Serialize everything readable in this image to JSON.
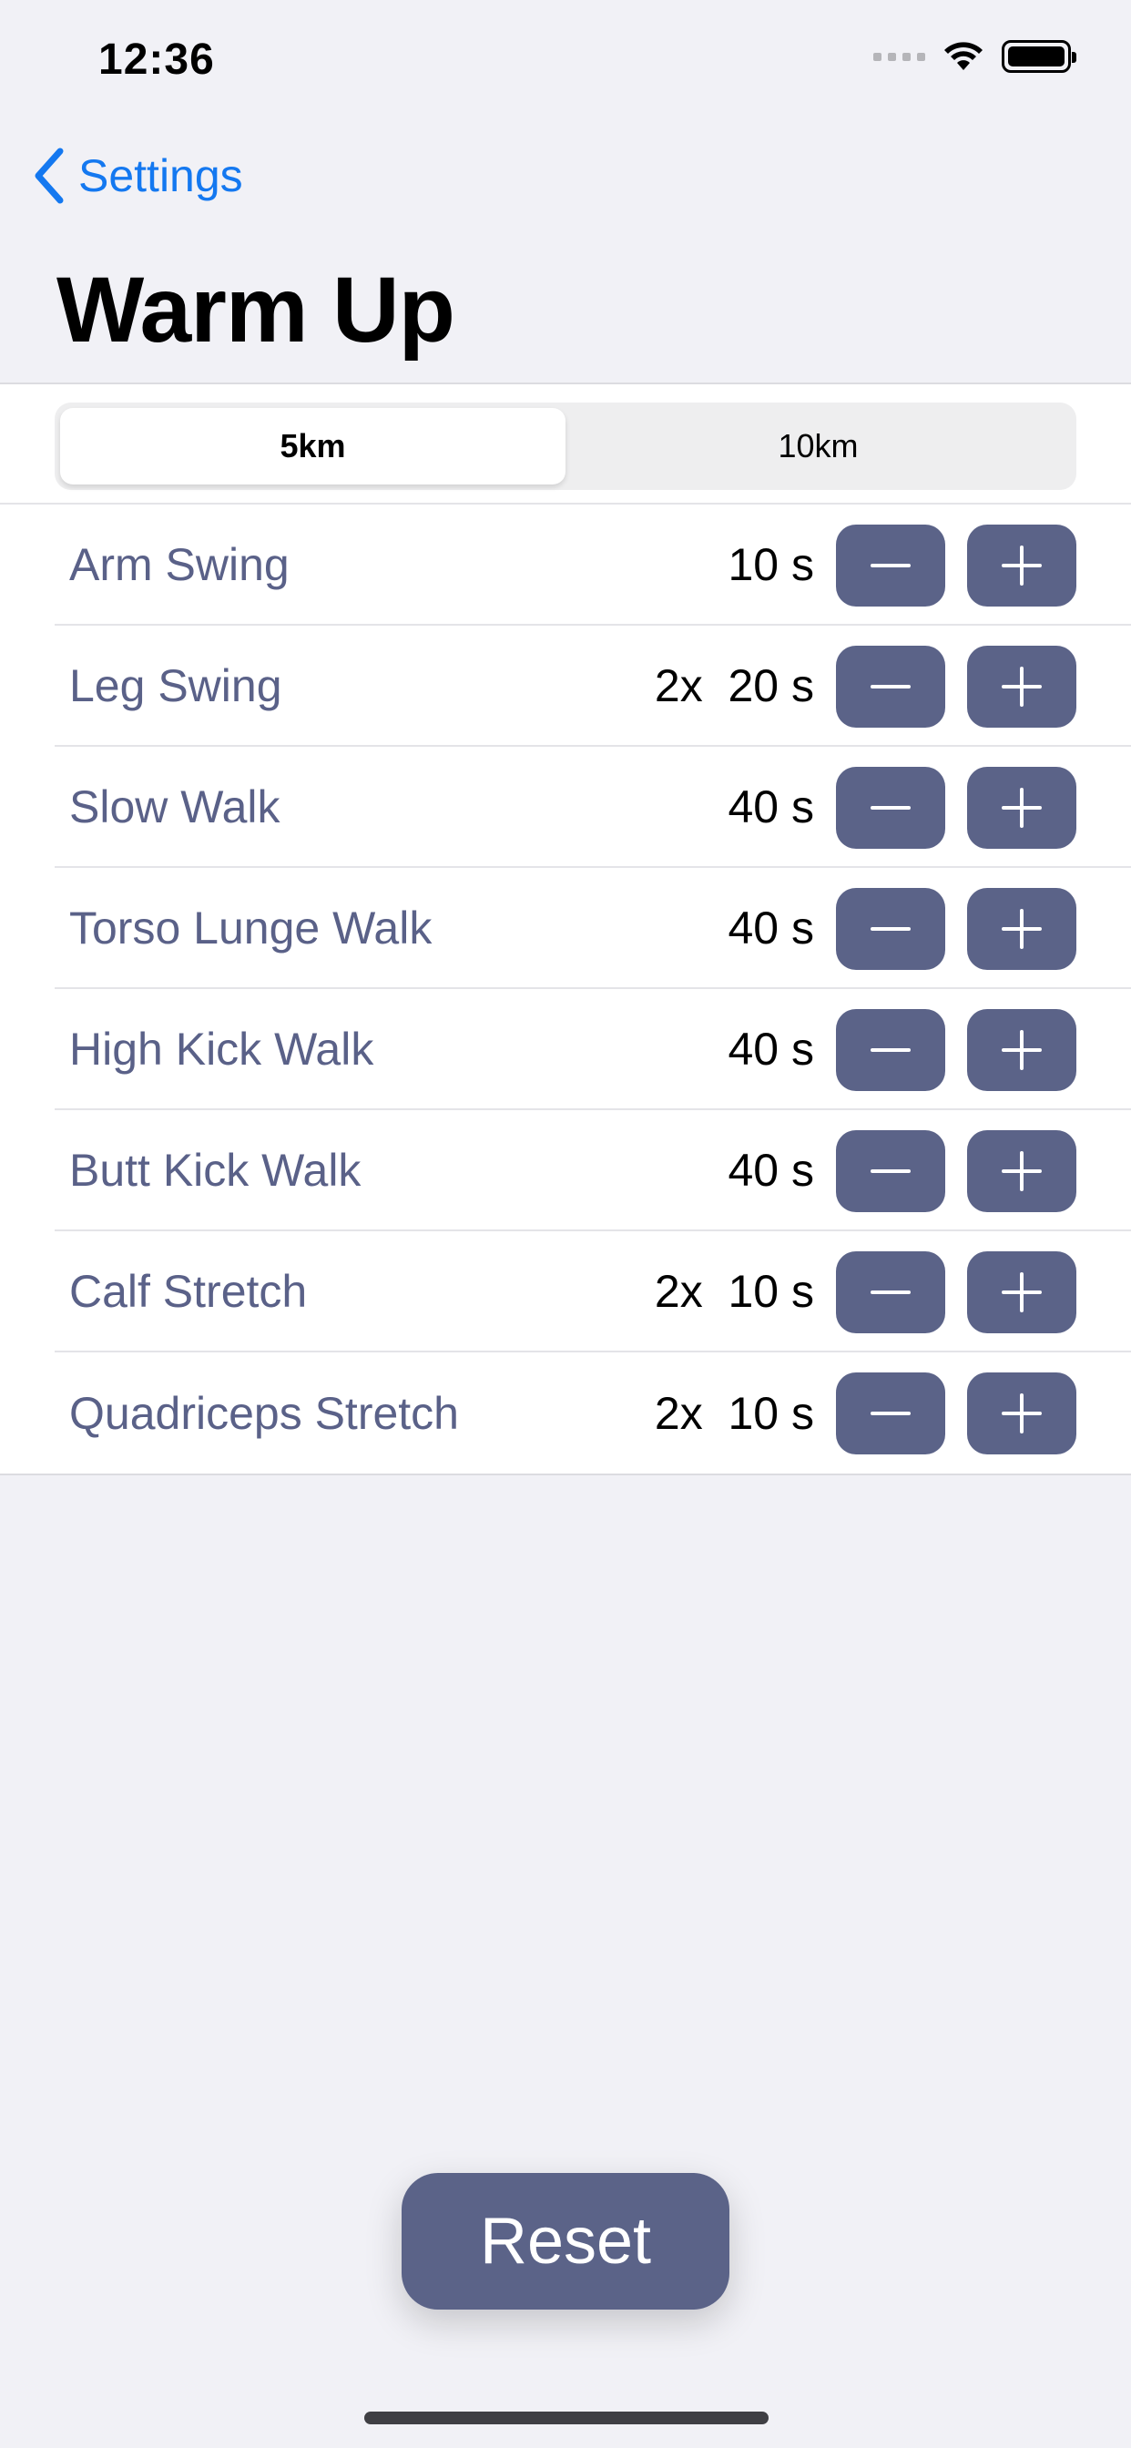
{
  "status_bar": {
    "time": "12:36"
  },
  "nav": {
    "back_label": "Settings",
    "title": "Warm Up"
  },
  "segments": [
    {
      "label": "5km",
      "selected": true
    },
    {
      "label": "10km",
      "selected": false
    }
  ],
  "exercises": [
    {
      "name": "Arm Swing",
      "value": "10 s"
    },
    {
      "name": "Leg Swing",
      "value": "2x  20 s"
    },
    {
      "name": "Slow Walk",
      "value": "40 s"
    },
    {
      "name": "Torso Lunge Walk",
      "value": "40 s"
    },
    {
      "name": "High Kick Walk",
      "value": "40 s"
    },
    {
      "name": "Butt Kick Walk",
      "value": "40 s"
    },
    {
      "name": "Calf Stretch",
      "value": "2x  10 s"
    },
    {
      "name": "Quadriceps Stretch",
      "value": "2x  10 s"
    }
  ],
  "reset_label": "Reset",
  "icons": {
    "back": "chevron-left-icon",
    "minus": "minus-icon",
    "plus": "plus-icon",
    "wifi": "wifi-icon",
    "battery": "battery-icon",
    "signal": "cellular-signal-icon"
  },
  "colors": {
    "accent": "#1478f0",
    "button": "#5b6388",
    "label": "#5a6188",
    "background": "#f1f1f6"
  }
}
